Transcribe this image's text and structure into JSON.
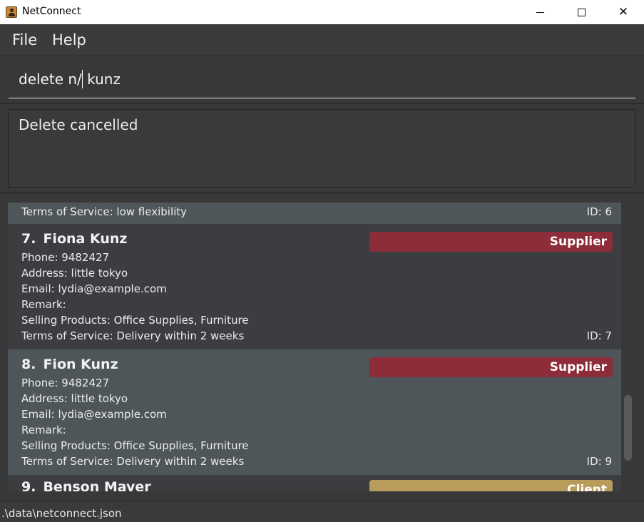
{
  "window": {
    "title": "NetConnect",
    "icon": "address-book-icon",
    "minimize_glyph": "minimize-icon",
    "maximize_glyph": "maximize-icon",
    "close_glyph": "✕"
  },
  "menu": {
    "file": "File",
    "help": "Help"
  },
  "command": {
    "value_before_caret": "delete n/",
    "value_after_caret": " kunz"
  },
  "result": {
    "message": "Delete cancelled"
  },
  "persons": {
    "top_partial": {
      "tos": "Terms of Service: low flexibility",
      "id": "ID: 6"
    },
    "items": [
      {
        "index": "7.",
        "name": "Fiona Kunz",
        "tag": "Supplier",
        "phone": "Phone: 9482427",
        "address": "Address: little tokyo",
        "email": "Email: lydia@example.com",
        "remark": "Remark:",
        "products": "Selling Products: Office Supplies, Furniture",
        "tos": "Terms of Service: Delivery within 2 weeks",
        "id": "ID: 7"
      },
      {
        "index": "8.",
        "name": "Fion Kunz",
        "tag": "Supplier",
        "phone": "Phone: 9482427",
        "address": "Address: little tokyo",
        "email": "Email: lydia@example.com",
        "remark": "Remark:",
        "products": "Selling Products: Office Supplies, Furniture",
        "tos": "Terms of Service: Delivery within 2 weeks",
        "id": "ID: 9"
      },
      {
        "index": "9.",
        "name": "Benson Mayer",
        "tag": "Client"
      }
    ]
  },
  "colors": {
    "supplier_tag": "#8c2d39",
    "client_tag": "#b99c5a"
  },
  "status": {
    "path": ".\\data\\netconnect.json"
  }
}
